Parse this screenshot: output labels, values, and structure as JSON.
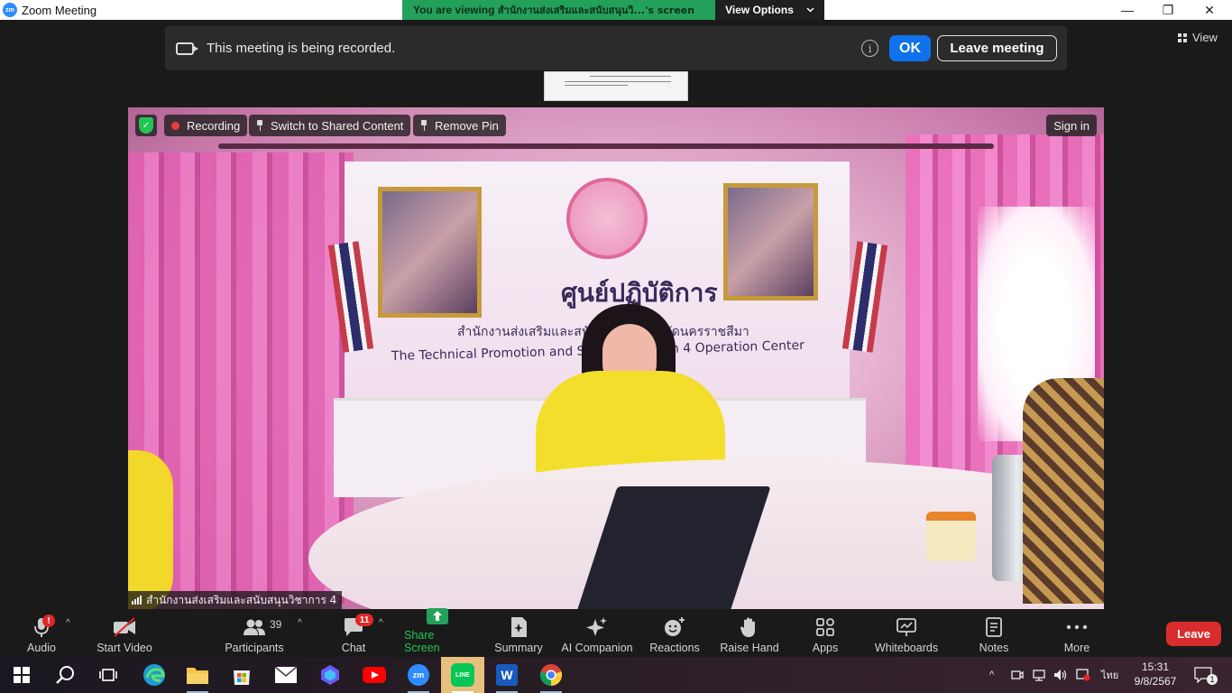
{
  "window": {
    "logo_text": "zm",
    "title": "Zoom Meeting",
    "controls": {
      "minimize": "—",
      "restore": "❐",
      "close": "✕"
    }
  },
  "share_banner": {
    "prefix": "You are viewing ",
    "sharer": "สำนักงานส่งเสริมและสนับสนุนวิ...'s screen",
    "view_options_label": "View Options",
    "accent": "#23a15b"
  },
  "recording_banner": {
    "message": "This meeting is being recorded.",
    "info_symbol": "i",
    "ok_label": "OK",
    "leave_meeting_label": "Leave meeting"
  },
  "view_button": {
    "label": "View"
  },
  "video": {
    "pills": {
      "shield_check": "✓",
      "recording": "Recording",
      "switch_shared": "Switch to Shared Content",
      "remove_pin": "Remove Pin",
      "sign_in": "Sign in"
    },
    "participant_name": "สำนักงานส่งเสริมและสนับสนุนวิชาการ 4",
    "sign": {
      "thai_title": "ศูนย์ปฏิบัติการ",
      "thai_sub": "สำนักงานส่งเสริมและสนั...  ...ร ๔ จังหวัดนครราชสีมา",
      "english": "The Technical Promotion and S...   ...ce, Region 4 Operation Center"
    }
  },
  "toolbar": {
    "audio": {
      "label": "Audio",
      "badge": "!"
    },
    "start_video": {
      "label": "Start Video"
    },
    "participants": {
      "label": "Participants",
      "count": "39"
    },
    "chat": {
      "label": "Chat",
      "badge": "11"
    },
    "share_screen": {
      "label": "Share Screen",
      "color": "#23a15b"
    },
    "summary": {
      "label": "Summary"
    },
    "ai_companion": {
      "label": "AI Companion"
    },
    "reactions": {
      "label": "Reactions"
    },
    "raise_hand": {
      "label": "Raise Hand"
    },
    "apps": {
      "label": "Apps"
    },
    "whiteboards": {
      "label": "Whiteboards"
    },
    "notes": {
      "label": "Notes"
    },
    "more": {
      "label": "More"
    },
    "leave": {
      "label": "Leave",
      "color": "#d92d2d"
    },
    "caret": "^"
  },
  "taskbar": {
    "apps": [
      "start-icon",
      "search-icon",
      "task-view-icon",
      "edge-icon",
      "file-explorer-icon",
      "microsoft-store-icon",
      "mail-icon",
      "copilot-icon",
      "youtube-icon",
      "zoom-icon",
      "line-icon",
      "word-icon",
      "chrome-icon"
    ],
    "zoom_text": "zm",
    "line_text": "LINE",
    "word_text": "W",
    "tray": {
      "chevron": "^",
      "language": "ไทย",
      "time": "15:31",
      "date": "9/8/2567",
      "notifications": "1"
    }
  }
}
